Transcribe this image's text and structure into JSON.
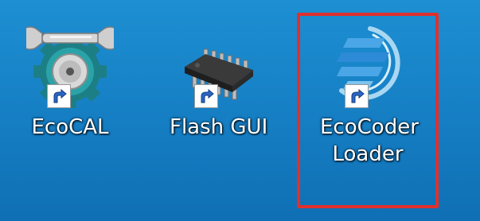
{
  "desktop": {
    "icons": [
      {
        "label": "EcoCAL",
        "icon": "wrench-gear-icon"
      },
      {
        "label": "Flash GUI",
        "icon": "chip-icon"
      },
      {
        "label_line1": "EcoCoder",
        "label_line2": "Loader",
        "icon": "ecocoder-logo-icon",
        "highlighted": true
      }
    ],
    "shortcut_overlay": "shortcut-arrow-icon"
  },
  "colors": {
    "desktop_background": "#1781c6",
    "highlight_border": "#e0302e",
    "label_text": "#ffffff"
  }
}
